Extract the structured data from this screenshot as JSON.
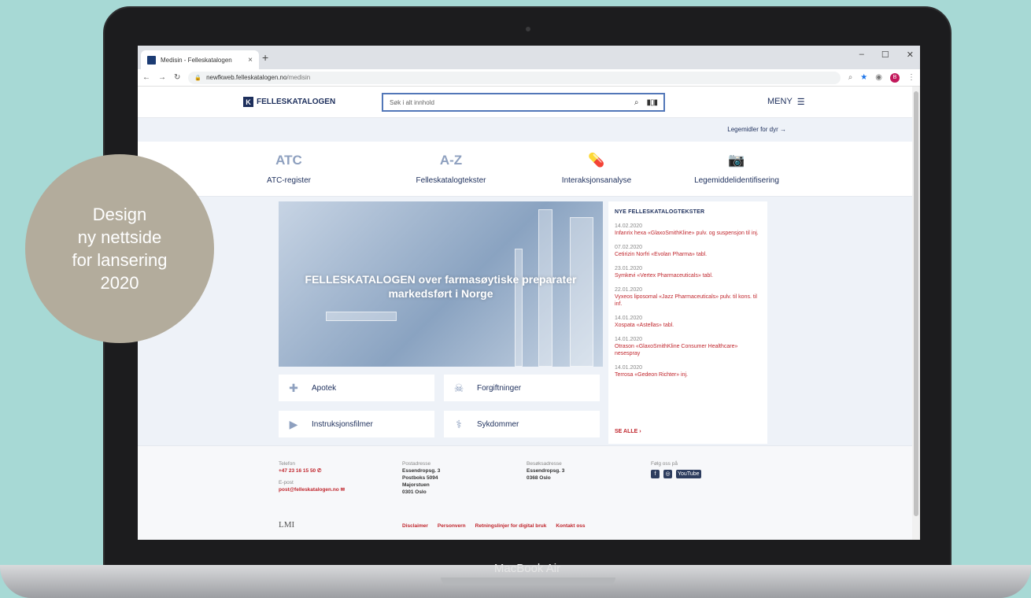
{
  "badge": {
    "lines": [
      "Design",
      "ny nettside",
      "for lansering",
      "2020"
    ]
  },
  "device": {
    "label": "MacBook Air"
  },
  "browser": {
    "tab_title": "Medisin - Felleskatalogen",
    "tab_close": "×",
    "new_tab": "+",
    "url_host": "newfkweb.felleskatalogen.no",
    "url_path": "/medisin",
    "profile_initial": "B"
  },
  "header": {
    "logo": "FELLESKATALOGEN",
    "search_placeholder": "Søk i alt innhold",
    "menu_label": "MENY"
  },
  "subbar": {
    "vet_link": "Legemidler for dyr"
  },
  "quicknav": [
    {
      "big": "ATC",
      "label": "ATC-register"
    },
    {
      "big": "A-Z",
      "label": "Felleskatalogtekster"
    },
    {
      "big": "",
      "label": "Interaksjonsanalyse"
    },
    {
      "big": "",
      "label": "Legemiddelidentifisering"
    }
  ],
  "hero": {
    "line1": "FELLESKATALOGEN over farmasøytiske preparater",
    "line2": "markedsført i Norge"
  },
  "cards": [
    {
      "label": "Apotek",
      "icon": "pharmacy-icon"
    },
    {
      "label": "Forgiftninger",
      "icon": "skull-icon"
    },
    {
      "label": "Instruksjonsfilmer",
      "icon": "play-icon"
    },
    {
      "label": "Sykdommer",
      "icon": "lungs-icon"
    }
  ],
  "news": {
    "heading": "NYE FELLESKATALOGTEKSTER",
    "items": [
      {
        "date": "14.02.2020",
        "title": "Infanrix hexa «GlaxoSmithKline» pulv. og suspensjon til inj."
      },
      {
        "date": "07.02.2020",
        "title": "Cetirizin Norfri «Evolan Pharma» tabl."
      },
      {
        "date": "23.01.2020",
        "title": "Symkevi «Vertex Pharmaceuticals» tabl."
      },
      {
        "date": "22.01.2020",
        "title": "Vyxeos liposomal «Jazz Pharmaceuticals» pulv. til kons. til inf."
      },
      {
        "date": "14.01.2020",
        "title": "Xospata «Astellas» tabl."
      },
      {
        "date": "14.01.2020",
        "title": "Otrason «GlaxoSmithKline Consumer Healthcare» nesespray"
      },
      {
        "date": "14.01.2020",
        "title": "Terrosa «Gedeon Richter» inj."
      }
    ],
    "see_all": "SE ALLE"
  },
  "footer": {
    "phone_label": "Telefon",
    "phone": "+47 23 16 15 50",
    "email_label": "E-post",
    "email": "post@felleskatalogen.no",
    "post_label": "Postadresse",
    "post_lines": [
      "Essendropsg. 3",
      "Postboks 5094",
      "Majorstuen",
      "0301 Oslo"
    ],
    "visit_label": "Besøksadresse",
    "visit_lines": [
      "Essendropsg. 3",
      "0368 Oslo"
    ],
    "follow_label": "Følg oss på",
    "social_youtube": "YouTube",
    "lmi": "LMI",
    "links": [
      "Disclaimer",
      "Personvern",
      "Retningslinjer for digital bruk",
      "Kontakt oss"
    ]
  }
}
